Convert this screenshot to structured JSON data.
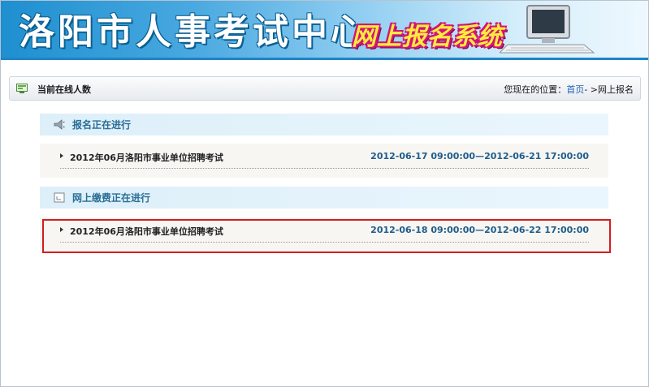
{
  "header": {
    "title": "洛阳市人事考试中心",
    "system_name": "网上报名系统"
  },
  "statusbar": {
    "online_label": "当前在线人数",
    "location_prefix": "您现在的位置：",
    "home_link": "首页",
    "location_suffix": "- >网上报名"
  },
  "sections": [
    {
      "title": "报名正在进行",
      "icon": "megaphone-icon",
      "items": [
        {
          "name": "2012年06月洛阳市事业单位招聘考试",
          "time": "2012-06-17 09:00:00—2012-06-21 17:00:00"
        }
      ]
    },
    {
      "title": "网上缴费正在进行",
      "icon": "document-icon",
      "items": [
        {
          "name": "2012年06月洛阳市事业单位招聘考试",
          "time": "2012-06-18 09:00:00—2012-06-22 17:00:00"
        }
      ]
    }
  ],
  "colors": {
    "header_blue": "#1f84c6",
    "section_text": "#2a6e96",
    "time_text": "#1f5c8c",
    "highlight_border": "#d21d1d"
  }
}
